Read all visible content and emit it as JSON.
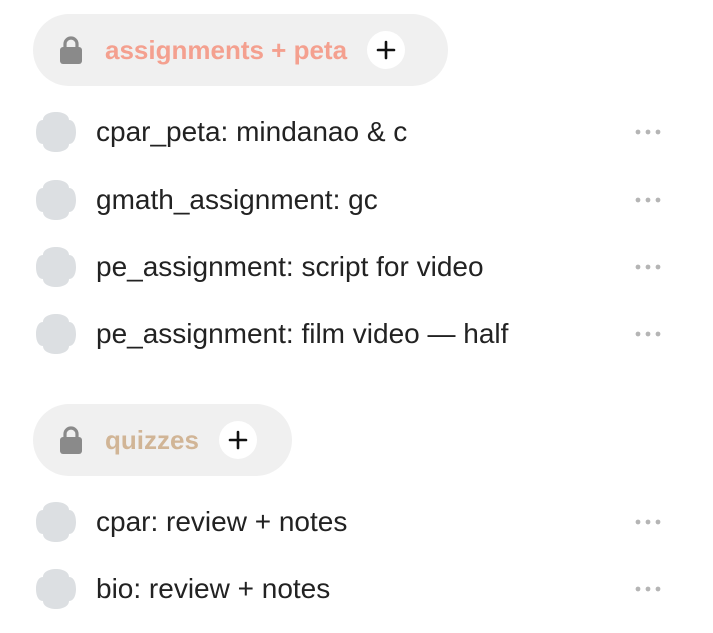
{
  "colors": {
    "pill_background": "#f0f0f0",
    "lock_icon": "#8a8a8a",
    "task_icon": "#dcdfe2",
    "more_icon": "#b5b5b5"
  },
  "groups": [
    {
      "title": "assignments + peta",
      "title_color": "#f4a08f",
      "lock_icon": "lock-icon",
      "add_icon": "plus-icon",
      "tasks": [
        {
          "label": "cpar_peta: mindanao & c"
        },
        {
          "label": "gmath_assignment: gc"
        },
        {
          "label": "pe_assignment: script for video"
        },
        {
          "label": "pe_assignment: film video — half"
        }
      ]
    },
    {
      "title": "quizzes",
      "title_color": "#d1b596",
      "lock_icon": "lock-icon",
      "add_icon": "plus-icon",
      "tasks": [
        {
          "label": "cpar: review + notes"
        },
        {
          "label": "bio: review + notes"
        }
      ]
    }
  ]
}
